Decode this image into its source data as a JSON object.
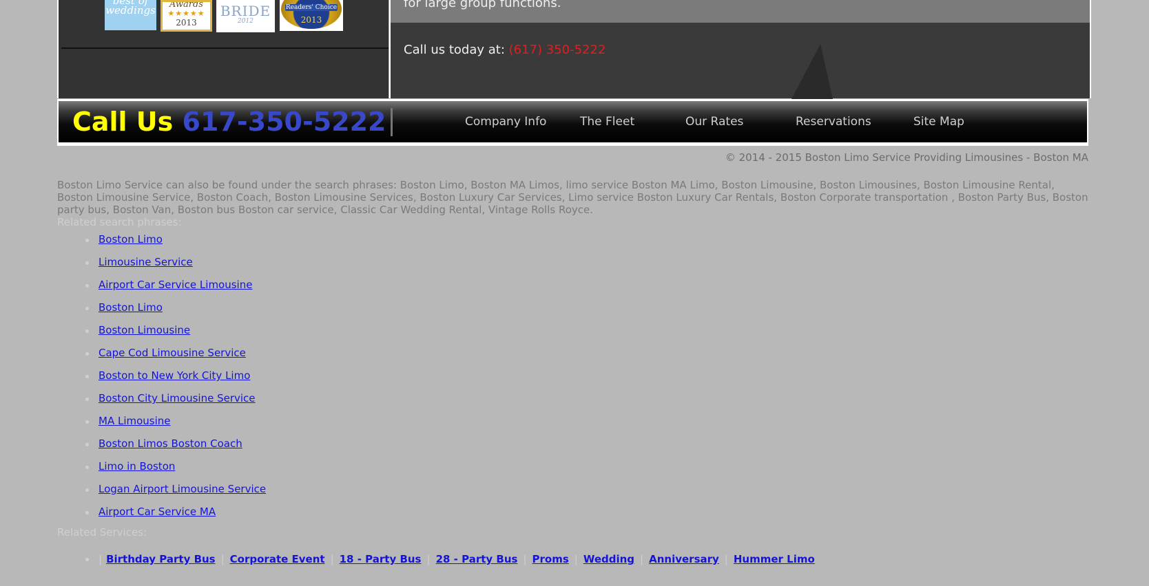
{
  "awards": {
    "badge1": "best of weddings",
    "badge2_title": "Awards",
    "badge2_stars": "★★★★★",
    "badge2_year": "2013",
    "badge3_title": "BRIDE",
    "badge3_year": "2012",
    "badge4_title": "Readers' Choice",
    "badge4_year": "2013"
  },
  "top": {
    "strip_text": "for large group functions.",
    "call_label": "Call us today at:",
    "call_number": "(617) 350-5222"
  },
  "navbar": {
    "call_label": "Call Us",
    "call_number": "617-350-5222",
    "items": [
      "Company Info",
      "The Fleet",
      "Our Rates",
      "Reservations",
      "Site Map"
    ]
  },
  "copyright": "© 2014 - 2015 Boston Limo Service Providing Limousines - Boston MA",
  "search_text": "Boston Limo Service can also be found under the search phrases: Boston Limo, Boston MA Limos, limo service Boston MA Limo, Boston Limousine, Boston Limousines, Boston Limousine Rental, Boston Limousine Service, Boston Coach, Boston Limousine Services, Boston Luxury Car Services, Limo service Boston Luxury Car Rentals, Boston Corporate transportation , Boston Party Bus, Boston party bus, Boston Van, Boston bus Boston car service, Classic Car Wedding Rental, Vintage Rolls Royce.",
  "related_title": "Related search phrases:",
  "related_links": [
    "Boston Limo",
    "Limousine Service",
    "Airport Car Service Limousine",
    "Boston Limo",
    "Boston Limousine",
    "Cape Cod Limousine Service",
    "Boston to New York City Limo",
    "Boston City Limousine Service",
    "MA Limousine",
    "Boston Limos Boston Coach",
    "Limo in Boston",
    "Logan Airport Limousine Service",
    "Airport Car Service MA"
  ],
  "services_title": "Related Services:",
  "services": [
    "Birthday Party Bus",
    "Corporate Event",
    "18 - Party Bus",
    "28 - Party Bus",
    "Proms",
    "Wedding",
    "Anniversary",
    "Hummer Limo"
  ]
}
